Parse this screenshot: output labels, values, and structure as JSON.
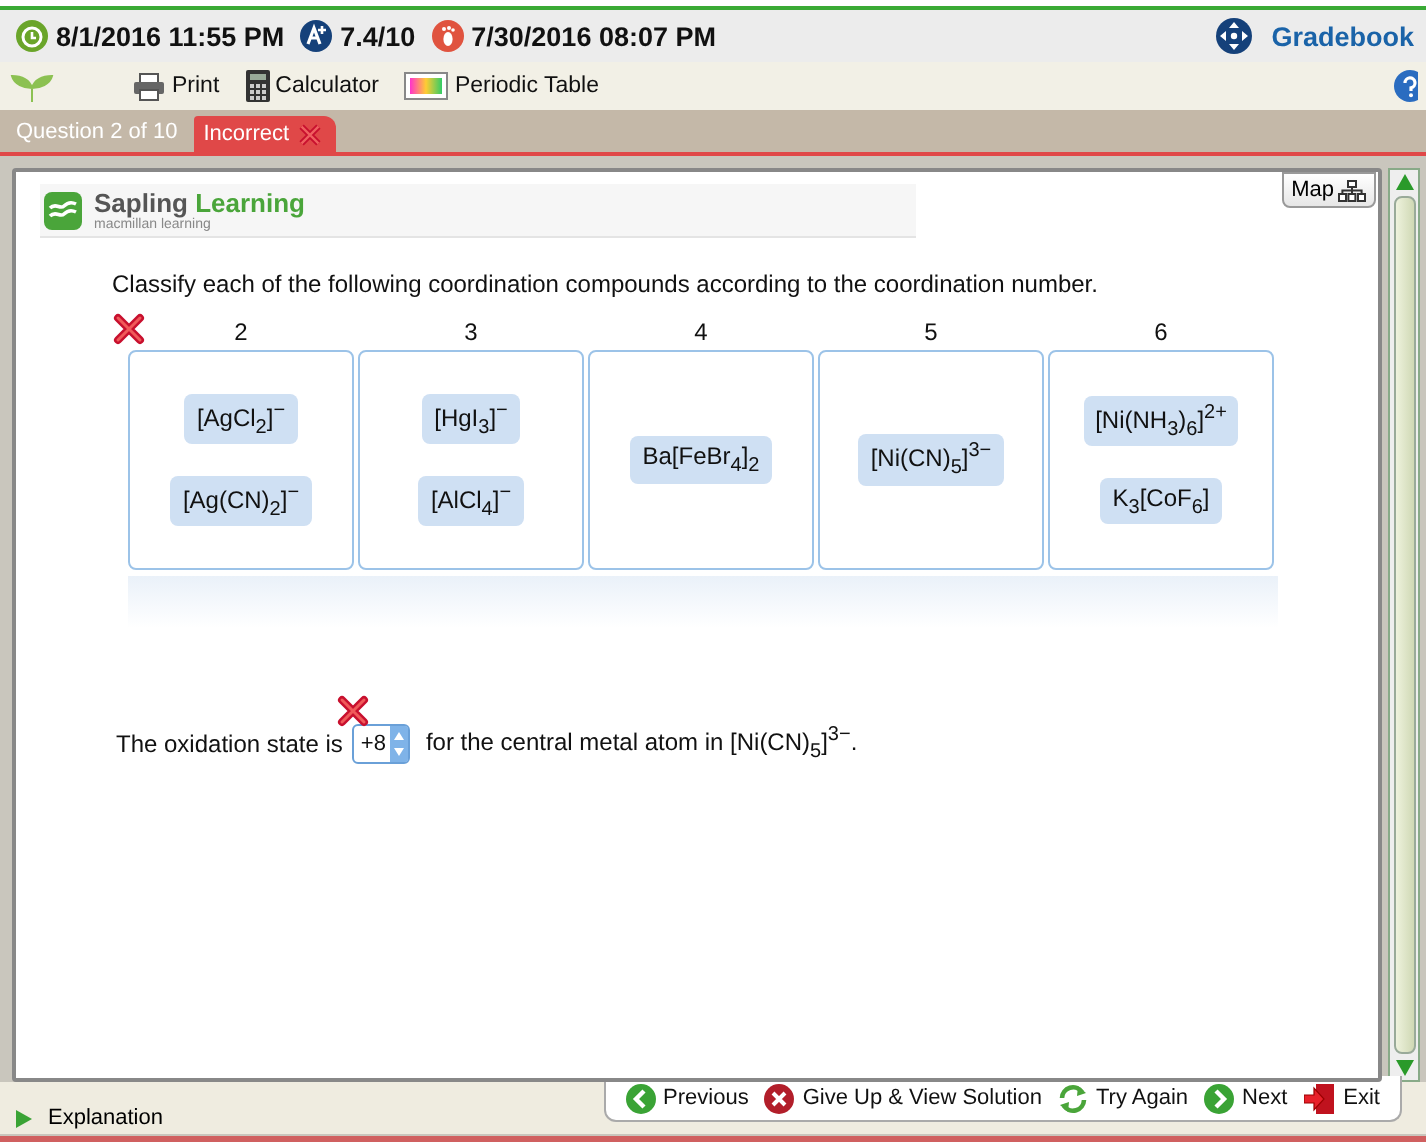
{
  "header": {
    "due": "8/1/2016 11:55 PM",
    "score": "7.4/10",
    "last_activity": "7/30/2016 08:07 PM",
    "gradebook": "Gradebook"
  },
  "toolbar": [
    {
      "label": "Print",
      "kind": "print"
    },
    {
      "label": "Calculator",
      "kind": "calculator"
    },
    {
      "label": "Periodic Table",
      "kind": "periodic"
    }
  ],
  "question": {
    "position": "Question 2 of 10",
    "result": "Incorrect",
    "correct": false
  },
  "logo": {
    "first": "Sapling",
    "second": "Learning",
    "tagline": "macmillan learning"
  },
  "map_button": "Map",
  "prompt": "Classify each of the following coordination compounds according to the coordination number.",
  "sorting": {
    "correct": false,
    "bins": [
      {
        "label": "2",
        "items": [
          "[AgCl$_{2}$]$^{−}$",
          "[Ag(CN)$_{2}$]$^{−}$"
        ]
      },
      {
        "label": "3",
        "items": [
          "[HgI$_{3}$]$^{−}$",
          "[AlCl$_{4}$]$^{−}$"
        ]
      },
      {
        "label": "4",
        "items": [
          "Ba[FeBr$_{4}$]$_{2}$"
        ]
      },
      {
        "label": "5",
        "items": [
          "[Ni(CN)$_{5}$]$^{3−}$"
        ]
      },
      {
        "label": "6",
        "items": [
          "[Ni(NH$_{3}$)$_{6}$]$^{2+}$",
          "K$_{3}$[CoF$_{6}$]"
        ]
      }
    ]
  },
  "oxidation": {
    "before": "The oxidation state is",
    "value": "+8",
    "correct": false,
    "after": "for the central metal atom in [Ni(CN)$_{5}$]$^{3−}$."
  },
  "explanation": "Explanation",
  "nav": [
    {
      "label": "Previous",
      "kind": "previous"
    },
    {
      "label": "Give Up & View Solution",
      "kind": "giveup"
    },
    {
      "label": "Try Again",
      "kind": "retry"
    },
    {
      "label": "Next",
      "kind": "next"
    },
    {
      "label": "Exit",
      "kind": "exit"
    }
  ]
}
